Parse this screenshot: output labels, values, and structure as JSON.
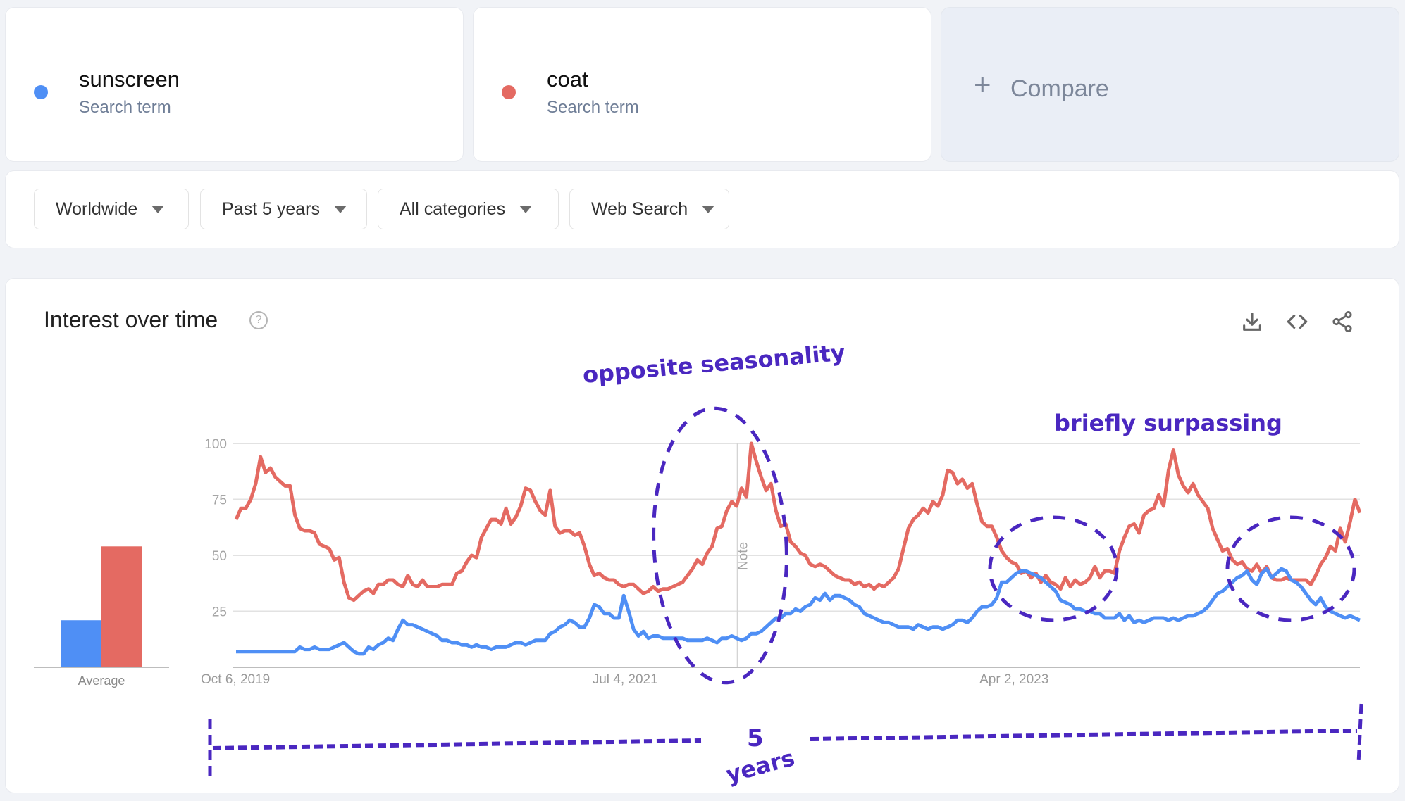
{
  "terms": [
    {
      "name": "sunscreen",
      "subtitle": "Search term",
      "color": "#4f8ff5"
    },
    {
      "name": "coat",
      "subtitle": "Search term",
      "color": "#e46a62"
    }
  ],
  "compare": {
    "icon": "plus-icon",
    "label": "Compare"
  },
  "filters": [
    {
      "label": "Worldwide"
    },
    {
      "label": "Past 5 years"
    },
    {
      "label": "All categories"
    },
    {
      "label": "Web Search"
    }
  ],
  "panel": {
    "title": "Interest over time",
    "help_icon": "?",
    "actions": [
      "download-icon",
      "embed-code-icon",
      "share-icon"
    ]
  },
  "annotations": {
    "seasonality": "opposite seasonality",
    "surpassing": "briefly surpassing",
    "span_number": "5",
    "span_unit": "years",
    "color": "#4a27c0"
  },
  "chart_data": {
    "type": "line",
    "title": "Interest over time",
    "xlabel": "",
    "ylabel": "",
    "ylim": [
      0,
      100
    ],
    "yticks": [
      25,
      50,
      75,
      100
    ],
    "grid": true,
    "x_tick_labels": [
      "Oct 6, 2019",
      "Jul 4, 2021",
      "Apr 2, 2023"
    ],
    "x_tick_positions": [
      0,
      0.3462,
      0.6923
    ],
    "note_marker": {
      "label": "Note",
      "position": 0.4462
    },
    "x_range": [
      "Oct 6, 2019",
      "Sep 2024"
    ],
    "average": {
      "label": "Average",
      "values": [
        {
          "name": "sunscreen",
          "value": 21
        },
        {
          "name": "coat",
          "value": 54
        }
      ]
    },
    "series": [
      {
        "name": "sunscreen",
        "color": "#4f8ff5",
        "values": [
          7,
          7,
          7,
          7,
          7,
          7,
          7,
          7,
          7,
          7,
          7,
          7,
          7,
          9,
          8,
          8,
          9,
          8,
          8,
          8,
          9,
          10,
          11,
          9,
          7,
          6,
          6,
          9,
          8,
          10,
          11,
          13,
          12,
          17,
          21,
          19,
          19,
          18,
          17,
          16,
          15,
          14,
          12,
          12,
          11,
          11,
          10,
          10,
          9,
          10,
          9,
          9,
          8,
          9,
          9,
          9,
          10,
          11,
          11,
          10,
          11,
          12,
          12,
          12,
          15,
          16,
          18,
          19,
          21,
          20,
          18,
          18,
          22,
          28,
          27,
          24,
          24,
          22,
          22,
          32,
          25,
          17,
          14,
          16,
          13,
          14,
          14,
          13,
          13,
          13,
          13,
          13,
          12,
          12,
          12,
          12,
          13,
          12,
          11,
          13,
          13,
          14,
          13,
          12,
          13,
          15,
          15,
          16,
          18,
          20,
          22,
          22,
          24,
          24,
          26,
          25,
          27,
          28,
          31,
          30,
          33,
          30,
          32,
          32,
          31,
          30,
          28,
          27,
          24,
          23,
          22,
          21,
          20,
          20,
          19,
          18,
          18,
          18,
          17,
          19,
          18,
          17,
          18,
          18,
          17,
          18,
          19,
          21,
          21,
          20,
          22,
          25,
          27,
          27,
          28,
          31,
          38,
          38,
          40,
          42,
          43,
          43,
          42,
          41,
          40,
          38,
          36,
          34,
          30,
          29,
          28,
          26,
          26,
          25,
          25,
          24,
          24,
          22,
          22,
          22,
          24,
          21,
          23,
          20,
          21,
          20,
          21,
          22,
          22,
          22,
          21,
          22,
          21,
          22,
          23,
          23,
          24,
          25,
          27,
          30,
          33,
          34,
          36,
          38,
          40,
          41,
          43,
          39,
          37,
          42,
          44,
          40,
          42,
          44,
          43,
          39,
          38,
          36,
          33,
          30,
          28,
          31,
          27,
          25,
          24,
          23,
          22,
          23,
          22,
          21
        ]
      },
      {
        "name": "coat",
        "color": "#e46a62",
        "values": [
          66,
          71,
          71,
          75,
          82,
          94,
          87,
          89,
          85,
          83,
          81,
          81,
          68,
          62,
          61,
          61,
          60,
          55,
          54,
          53,
          48,
          49,
          38,
          31,
          30,
          32,
          34,
          35,
          33,
          37,
          37,
          39,
          39,
          37,
          36,
          41,
          37,
          36,
          39,
          36,
          36,
          36,
          37,
          37,
          37,
          42,
          43,
          47,
          50,
          49,
          58,
          62,
          66,
          66,
          64,
          71,
          64,
          67,
          72,
          80,
          79,
          74,
          70,
          68,
          79,
          63,
          60,
          61,
          61,
          59,
          60,
          54,
          46,
          41,
          42,
          40,
          39,
          39,
          37,
          36,
          37,
          37,
          35,
          33,
          34,
          36,
          34,
          35,
          35,
          36,
          37,
          38,
          41,
          44,
          48,
          46,
          51,
          54,
          62,
          63,
          70,
          74,
          72,
          80,
          76,
          100,
          92,
          85,
          79,
          82,
          70,
          63,
          64,
          56,
          54,
          51,
          50,
          46,
          45,
          46,
          45,
          43,
          41,
          40,
          39,
          39,
          37,
          38,
          36,
          37,
          35,
          37,
          36,
          38,
          40,
          44,
          53,
          62,
          66,
          68,
          71,
          69,
          74,
          72,
          77,
          88,
          87,
          82,
          84,
          80,
          82,
          73,
          65,
          63,
          63,
          58,
          52,
          49,
          47,
          46,
          42,
          43,
          40,
          42,
          38,
          41,
          38,
          37,
          35,
          40,
          36,
          39,
          37,
          38,
          40,
          45,
          40,
          43,
          43,
          42,
          52,
          58,
          63,
          64,
          60,
          68,
          70,
          71,
          77,
          72,
          88,
          97,
          86,
          81,
          78,
          82,
          77,
          74,
          71,
          62,
          57,
          52,
          53,
          48,
          46,
          47,
          44,
          43,
          46,
          42,
          45,
          40,
          39,
          39,
          40,
          39,
          39,
          39,
          39,
          37,
          41,
          46,
          49,
          54,
          52,
          62,
          56,
          65,
          75,
          69
        ]
      }
    ]
  }
}
